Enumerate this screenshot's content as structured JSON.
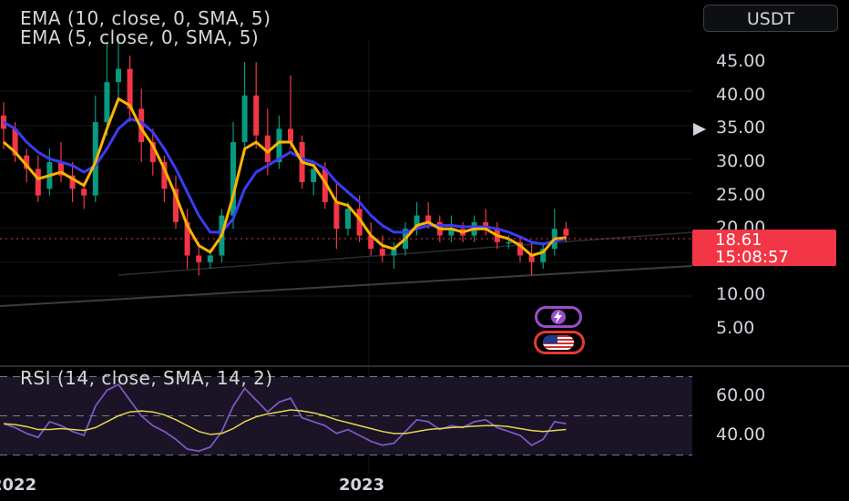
{
  "legend": {
    "ema1": "EMA (10, close, 0, SMA, 5)",
    "ema2": "EMA (5, close, 0, SMA, 5)",
    "rsi": "RSI (14, close, SMA, 14, 2)"
  },
  "currency_button": "USDT",
  "price_label": {
    "price": "18.61",
    "countdown": "15:08:57"
  },
  "colors": {
    "up": "#089981",
    "down": "#f23645",
    "ema_fast": "#ffb300",
    "ema_slow": "#3b3bf5",
    "rsi": "#7e57c2",
    "rsi_ma": "#e8d44d",
    "price_box": "#f23645"
  },
  "icons": [
    "lightning-icon",
    "us-flag-icon",
    "price-marker-icon"
  ],
  "chart_data": {
    "type": "line",
    "price_axis": {
      "ticks": [
        "45.00",
        "40.00",
        "35.00",
        "30.00",
        "25.00",
        "20.00",
        "10.00",
        "5.00"
      ],
      "ylim": [
        2,
        50
      ]
    },
    "rsi_axis": {
      "ticks": [
        "60.00",
        "40.00"
      ],
      "ylim": [
        22,
        72
      ]
    },
    "x_labels": [
      "2022",
      "2023"
    ],
    "current_price": 18.61,
    "candles": [
      [
        37,
        39,
        32,
        35
      ],
      [
        35,
        36,
        30,
        31
      ],
      [
        31,
        32,
        27,
        29
      ],
      [
        29,
        31,
        24,
        25
      ],
      [
        26,
        32,
        25,
        30
      ],
      [
        30,
        33,
        27,
        28
      ],
      [
        28,
        30,
        24,
        26
      ],
      [
        26,
        27,
        23,
        25
      ],
      [
        25,
        40,
        24,
        36
      ],
      [
        36,
        48,
        34,
        42
      ],
      [
        42,
        49,
        39,
        44
      ],
      [
        44,
        46,
        36,
        38
      ],
      [
        38,
        41,
        30,
        33
      ],
      [
        33,
        35,
        28,
        30
      ],
      [
        30,
        31,
        24,
        26
      ],
      [
        26,
        28,
        20,
        21
      ],
      [
        21,
        23,
        14,
        16
      ],
      [
        16,
        18,
        13,
        15
      ],
      [
        15,
        17,
        14,
        16
      ],
      [
        16,
        23,
        15,
        22
      ],
      [
        22,
        36,
        20,
        33
      ],
      [
        33,
        45,
        31,
        40
      ],
      [
        40,
        45,
        32,
        34
      ],
      [
        34,
        38,
        28,
        30
      ],
      [
        30,
        37,
        29,
        35
      ],
      [
        35,
        43,
        32,
        33
      ],
      [
        33,
        34,
        26,
        27
      ],
      [
        27,
        30,
        25,
        29
      ],
      [
        29,
        30,
        23,
        24
      ],
      [
        24,
        27,
        17,
        20
      ],
      [
        20,
        24,
        19,
        23
      ],
      [
        23,
        25,
        18,
        19
      ],
      [
        19,
        21,
        16,
        17
      ],
      [
        17,
        19,
        15,
        16
      ],
      [
        16,
        18,
        14,
        17
      ],
      [
        17,
        21,
        16,
        20
      ],
      [
        20,
        24,
        19,
        22
      ],
      [
        22,
        24,
        20,
        21
      ],
      [
        21,
        22,
        18,
        19
      ],
      [
        19,
        22,
        18,
        20
      ],
      [
        20,
        21,
        18,
        19
      ],
      [
        19,
        22,
        18,
        21
      ],
      [
        21,
        23,
        19,
        20
      ],
      [
        20,
        21,
        17,
        18
      ],
      [
        18,
        19,
        17,
        18
      ],
      [
        18,
        19,
        15,
        16
      ],
      [
        16,
        18,
        13,
        15
      ],
      [
        15,
        18,
        14,
        17
      ],
      [
        17,
        23,
        16,
        20
      ],
      [
        20,
        21,
        18,
        19
      ]
    ],
    "ema_fast": [
      33,
      31.5,
      29.5,
      27.5,
      28,
      28.5,
      27.5,
      26.5,
      30,
      35,
      39.5,
      38.5,
      35,
      32.5,
      29,
      25,
      20.5,
      17.5,
      16.5,
      19,
      25,
      32,
      33,
      31.5,
      33,
      33,
      30,
      29.5,
      27,
      24,
      23.5,
      21.5,
      19,
      17.5,
      17,
      18.5,
      20.5,
      21,
      20,
      20,
      19.5,
      20,
      20,
      19,
      18.5,
      17.5,
      16,
      16.5,
      18.5,
      18.7
    ],
    "ema_slow": [
      36,
      35,
      33,
      31.5,
      30.5,
      30,
      29.5,
      28.5,
      29.5,
      32,
      35,
      36.5,
      36,
      34.5,
      32,
      29,
      25.5,
      22,
      19.5,
      19.5,
      21.5,
      26,
      28.5,
      29.5,
      30.5,
      31.5,
      30.5,
      30,
      29,
      27,
      25.5,
      24,
      22,
      20.5,
      19.5,
      19.5,
      20,
      20.5,
      20.5,
      20.5,
      20.3,
      20.3,
      20.3,
      20,
      19.5,
      18.8,
      18,
      17.7,
      18.2,
      18.5
    ],
    "rsi": [
      46,
      44,
      41,
      39,
      47,
      45,
      42,
      40,
      55,
      63,
      66,
      58,
      50,
      45,
      42,
      38,
      33,
      32,
      34,
      42,
      55,
      64,
      58,
      52,
      57,
      59,
      49,
      47,
      45,
      41,
      43,
      40,
      37,
      35,
      36,
      42,
      48,
      47,
      43,
      45,
      44,
      47,
      48,
      44,
      42,
      40,
      35,
      38,
      47,
      46
    ],
    "rsi_ma": [
      46,
      45.5,
      44.5,
      43,
      43,
      43.5,
      43,
      42.5,
      44,
      47,
      50,
      52,
      52.5,
      52,
      50.5,
      48,
      45,
      42,
      40.5,
      41,
      43.5,
      47,
      49.5,
      51,
      52,
      53,
      52.5,
      51.5,
      50,
      48,
      46.5,
      45,
      43.5,
      42,
      41,
      41,
      42,
      43,
      43.5,
      44,
      44.3,
      44.7,
      45,
      45,
      44.5,
      43.5,
      42.5,
      42,
      42.5,
      43
    ]
  }
}
